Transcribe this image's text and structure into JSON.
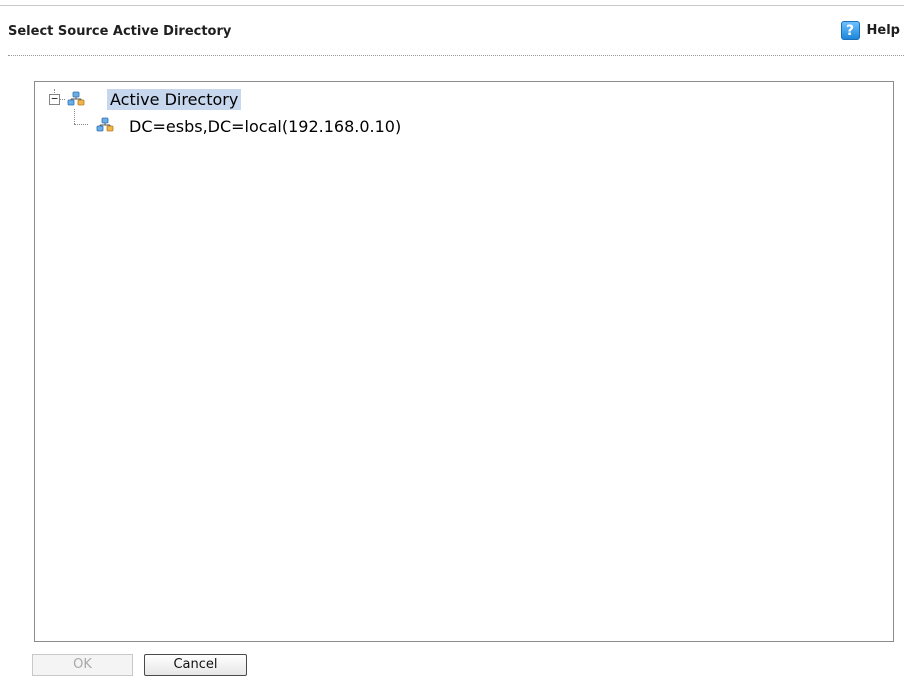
{
  "dialog": {
    "title": "Select Source Active Directory",
    "help_label": "Help",
    "help_icon": "help-icon"
  },
  "tree": {
    "root": {
      "label": "Active Directory",
      "icon": "directory-network-icon",
      "expanded": true,
      "selected": true
    },
    "children": [
      {
        "label": "DC=esbs,DC=local(192.168.0.10)",
        "icon": "directory-network-icon"
      }
    ]
  },
  "buttons": {
    "ok_label": "OK",
    "ok_enabled": false,
    "cancel_label": "Cancel"
  },
  "colors": {
    "selection": "#c6d7ee",
    "help_icon": "#1e86d9"
  }
}
